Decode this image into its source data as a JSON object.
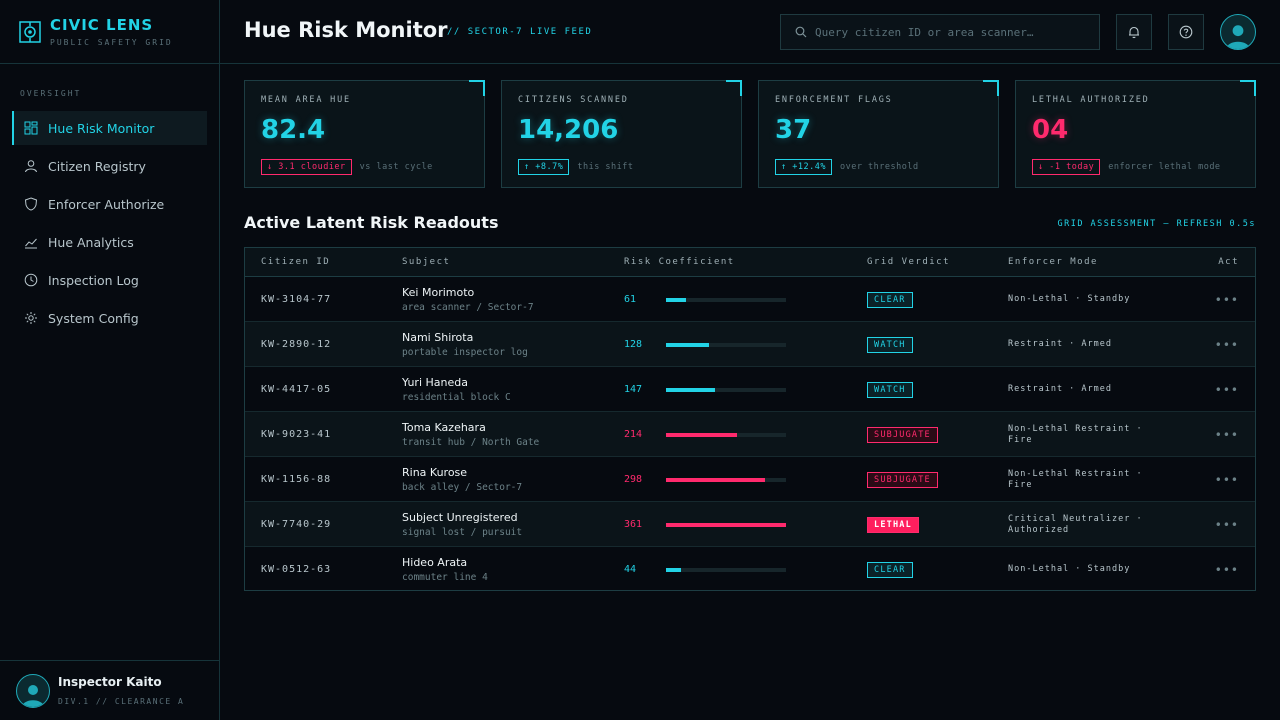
{
  "brand": {
    "title": "CIVIC LENS",
    "subtitle": "PUBLIC SAFETY GRID"
  },
  "sidebar": {
    "section_label": "OVERSIGHT",
    "items": [
      {
        "label": "Hue Risk Monitor",
        "icon": "dashboard-icon",
        "active": true
      },
      {
        "label": "Citizen Registry",
        "icon": "user-icon",
        "active": false
      },
      {
        "label": "Enforcer Authorize",
        "icon": "shield-icon",
        "active": false
      },
      {
        "label": "Hue Analytics",
        "icon": "chart-icon",
        "active": false
      },
      {
        "label": "Inspection Log",
        "icon": "clock-icon",
        "active": false
      },
      {
        "label": "System Config",
        "icon": "gear-icon",
        "active": false
      }
    ]
  },
  "user": {
    "name": "Inspector Kaito",
    "subtitle": "DIV.1 // CLEARANCE A"
  },
  "header": {
    "title": "Hue Risk Monitor",
    "tag": "// SECTOR-7 LIVE FEED",
    "search_placeholder": "Query citizen ID or area scanner…"
  },
  "kpis": [
    {
      "label": "MEAN AREA HUE",
      "value": "82.4",
      "delta": "3.1 cloudier",
      "direction": "down",
      "note": "vs last cycle",
      "tone": "cyan"
    },
    {
      "label": "CITIZENS SCANNED",
      "value": "14,206",
      "delta": "+8.7%",
      "direction": "up",
      "note": "this shift",
      "tone": "cyan"
    },
    {
      "label": "ENFORCEMENT FLAGS",
      "value": "37",
      "delta": "+12.4%",
      "direction": "up",
      "note": "over threshold",
      "tone": "cyan"
    },
    {
      "label": "LETHAL AUTHORIZED",
      "value": "04",
      "delta": "-1 today",
      "direction": "down",
      "note": "enforcer lethal mode",
      "tone": "red"
    }
  ],
  "table": {
    "title": "Active Latent Risk Readouts",
    "note": "GRID ASSESSMENT — REFRESH 0.5s",
    "columns": [
      "Citizen ID",
      "Subject",
      "Risk Coefficient",
      "Grid Verdict",
      "Enforcer Mode",
      "Act"
    ],
    "risk_max": 361,
    "rows": [
      {
        "id": "KW-3104-77",
        "name": "Kei Morimoto",
        "location": "area scanner / Sector-7",
        "risk": 61,
        "verdict": "CLEAR",
        "mode": "Non-Lethal · Standby"
      },
      {
        "id": "KW-2890-12",
        "name": "Nami Shirota",
        "location": "portable inspector log",
        "risk": 128,
        "verdict": "WATCH",
        "mode": "Restraint · Armed"
      },
      {
        "id": "KW-4417-05",
        "name": "Yuri Haneda",
        "location": "residential block C",
        "risk": 147,
        "verdict": "WATCH",
        "mode": "Restraint · Armed"
      },
      {
        "id": "KW-9023-41",
        "name": "Toma Kazehara",
        "location": "transit hub / North Gate",
        "risk": 214,
        "verdict": "SUBJUGATE",
        "mode": "Non-Lethal Restraint · Fire"
      },
      {
        "id": "KW-1156-88",
        "name": "Rina Kurose",
        "location": "back alley / Sector-7",
        "risk": 298,
        "verdict": "SUBJUGATE",
        "mode": "Non-Lethal Restraint · Fire"
      },
      {
        "id": "KW-7740-29",
        "name": "Subject Unregistered",
        "location": "signal lost / pursuit",
        "risk": 361,
        "verdict": "LETHAL",
        "mode": "Critical Neutralizer · Authorized"
      },
      {
        "id": "KW-0512-63",
        "name": "Hideo Arata",
        "location": "commuter line 4",
        "risk": 44,
        "verdict": "CLEAR",
        "mode": "Non-Lethal · Standby"
      }
    ]
  },
  "colors": {
    "accent": "#22d3e6",
    "danger": "#ff2a6d",
    "background": "#060a10"
  }
}
